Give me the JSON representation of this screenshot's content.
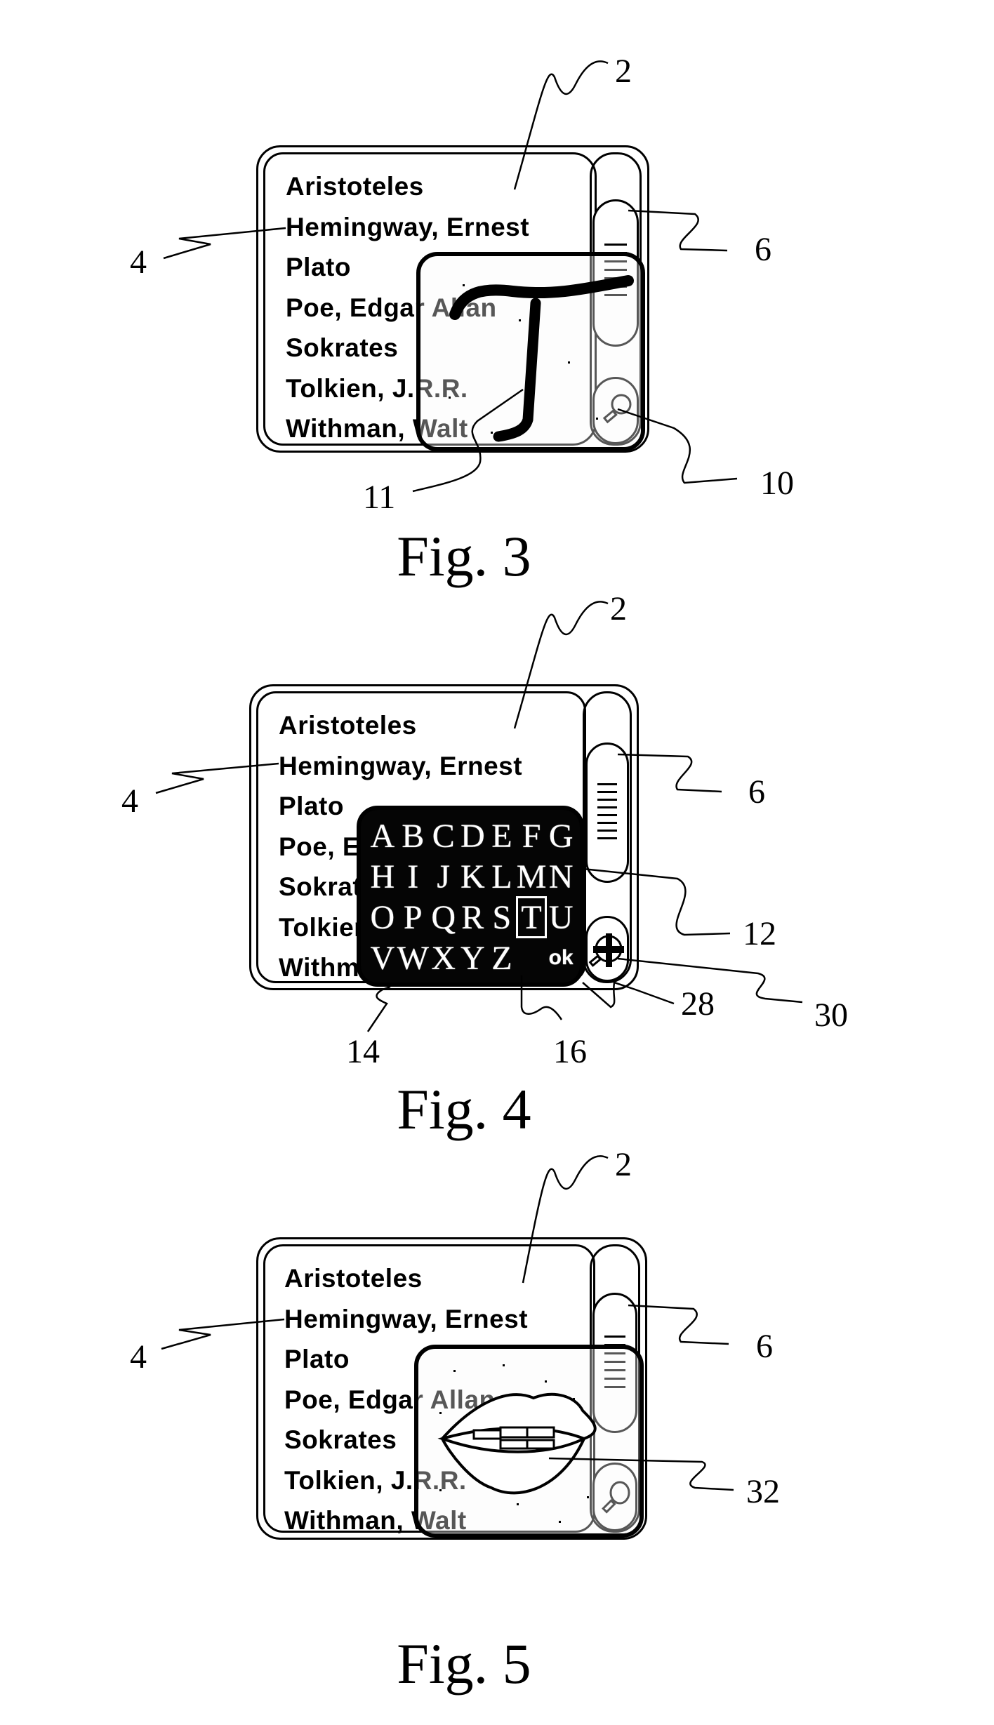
{
  "figures": [
    {
      "id": "fig3",
      "caption": "Fig. 3",
      "list_items": [
        "Aristoteles",
        "Hemingway, Ernest",
        "Plato",
        "Poe, Edgar Allan",
        "Sokrates",
        "Tolkien, J.R.R.",
        "Withman, Walt"
      ],
      "popup": "handwriting-input",
      "handwritten_character": "T",
      "side_button_icon": "magnifier-icon",
      "reference_numerals": {
        "device": "2",
        "list": "4",
        "scrollbar": "6",
        "input_window": "10",
        "handwriting_stroke": "11"
      }
    },
    {
      "id": "fig4",
      "caption": "Fig. 4",
      "list_items": [
        "Aristoteles",
        "Hemingway, Ernest",
        "Plato",
        "Poe, Edgar Allan",
        "Sokrates",
        "Tolkien, J.R.R.",
        "Withman, Walt"
      ],
      "popup": "virtual-keyboard",
      "keyboard_rows": [
        [
          "A",
          "B",
          "C",
          "D",
          "E",
          "F",
          "G"
        ],
        [
          "H",
          "I",
          "J",
          "K",
          "L",
          "M",
          "N"
        ],
        [
          "O",
          "P",
          "Q",
          "R",
          "S",
          "T",
          "U"
        ],
        [
          "V",
          "W",
          "X",
          "Y",
          "Z",
          "",
          "ok"
        ]
      ],
      "selected_key": "T",
      "side_button_icon": "magnifier-plus-icon",
      "reference_numerals": {
        "device": "2",
        "list": "4",
        "scrollbar": "6",
        "keyboard": "12",
        "keys": "14",
        "selected_key": "16",
        "ok_key": "28",
        "button": "30"
      }
    },
    {
      "id": "fig5",
      "caption": "Fig. 5",
      "list_items": [
        "Aristoteles",
        "Hemingway, Ernest",
        "Plato",
        "Poe, Edgar Allan",
        "Sokrates",
        "Tolkien, J.R.R.",
        "Withman, Walt"
      ],
      "popup": "voice-input",
      "popup_icon": "mouth-icon",
      "side_button_icon": "magnifier-icon",
      "reference_numerals": {
        "device": "2",
        "list": "4",
        "scrollbar": "6",
        "voice_window": "32"
      }
    }
  ]
}
